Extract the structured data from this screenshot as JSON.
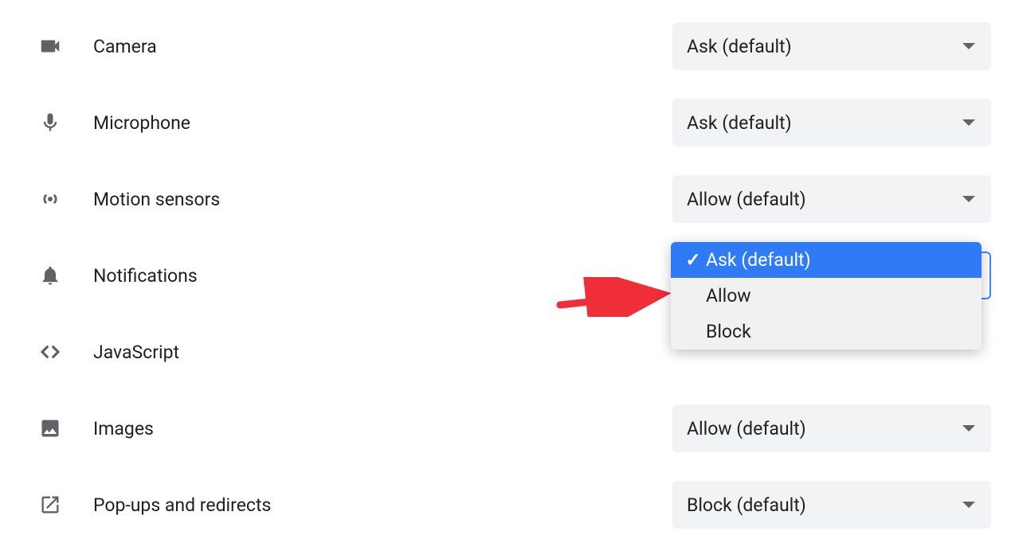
{
  "permissions": {
    "camera": {
      "label": "Camera",
      "value": "Ask (default)"
    },
    "microphone": {
      "label": "Microphone",
      "value": "Ask (default)"
    },
    "motion": {
      "label": "Motion sensors",
      "value": "Allow (default)"
    },
    "notifications": {
      "label": "Notifications",
      "value": "Ask (default)"
    },
    "javascript": {
      "label": "JavaScript",
      "value": ""
    },
    "images": {
      "label": "Images",
      "value": "Allow (default)"
    },
    "popups": {
      "label": "Pop-ups and redirects",
      "value": "Block (default)"
    }
  },
  "dropdown": {
    "options": {
      "ask": "Ask (default)",
      "allow": "Allow",
      "block": "Block"
    }
  }
}
